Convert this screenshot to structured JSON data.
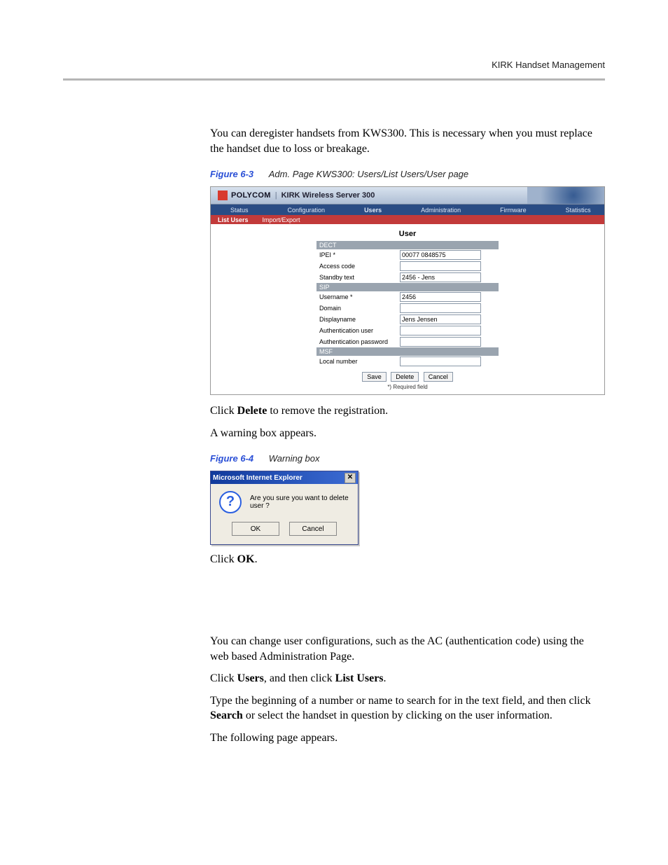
{
  "header": {
    "running_head": "KIRK Handset Management"
  },
  "intro": {
    "p1": "You can deregister handsets from KWS300. This is necessary when you must replace the handset due to loss or breakage."
  },
  "fig63": {
    "num": "Figure 6-3",
    "title": "Adm. Page KWS300: Users/List Users/User page",
    "brand": "POLYCOM",
    "product": "KIRK Wireless Server 300",
    "nav": [
      "Status",
      "Configuration",
      "Users",
      "Administration",
      "Firmware",
      "Statistics"
    ],
    "nav_active": "Users",
    "subnav": [
      "List Users",
      "Import/Export"
    ],
    "subnav_active": "List Users",
    "form_title": "User",
    "sections": {
      "dect": "DECT",
      "sip": "SIP",
      "msf": "MSF"
    },
    "labels": {
      "ipei": "IPEI *",
      "access_code": "Access code",
      "standby_text": "Standby text",
      "username": "Username *",
      "domain": "Domain",
      "displayname": "Displayname",
      "auth_user": "Authentication user",
      "auth_pass": "Authentication password",
      "local_number": "Local number"
    },
    "values": {
      "ipei": "00077 0848575",
      "access_code": "",
      "standby_text": "2456 - Jens",
      "username": "2456",
      "domain": "",
      "displayname": "Jens Jensen",
      "auth_user": "",
      "auth_pass": "",
      "local_number": ""
    },
    "buttons": {
      "save": "Save",
      "delete": "Delete",
      "cancel": "Cancel"
    },
    "footnote": "*) Required field"
  },
  "mid": {
    "p1a": "Click ",
    "p1b": "Delete",
    "p1c": " to remove the registration.",
    "p2": "A warning box appears."
  },
  "fig64": {
    "num": "Figure 6-4",
    "title": "Warning box",
    "dlg_title": "Microsoft Internet Explorer",
    "close_glyph": "✕",
    "question_glyph": "?",
    "message": "Are you sure you want to delete user ?",
    "ok": "OK",
    "cancel": "Cancel"
  },
  "after64": {
    "p1a": "Click ",
    "p1b": "OK",
    "p1c": "."
  },
  "section2": {
    "p1": "You can change user configurations, such as the AC (authentication code) using the web based Administration Page.",
    "s1a": "Click ",
    "s1b": "Users",
    "s1c": ", and then click ",
    "s1d": "List Users",
    "s1e": ".",
    "s2a": "Type the beginning of a number or name to search for in the text field, and then click ",
    "s2b": "Search",
    "s2c": " or select the handset in question by clicking on the user information.",
    "s3": "The following page appears."
  }
}
